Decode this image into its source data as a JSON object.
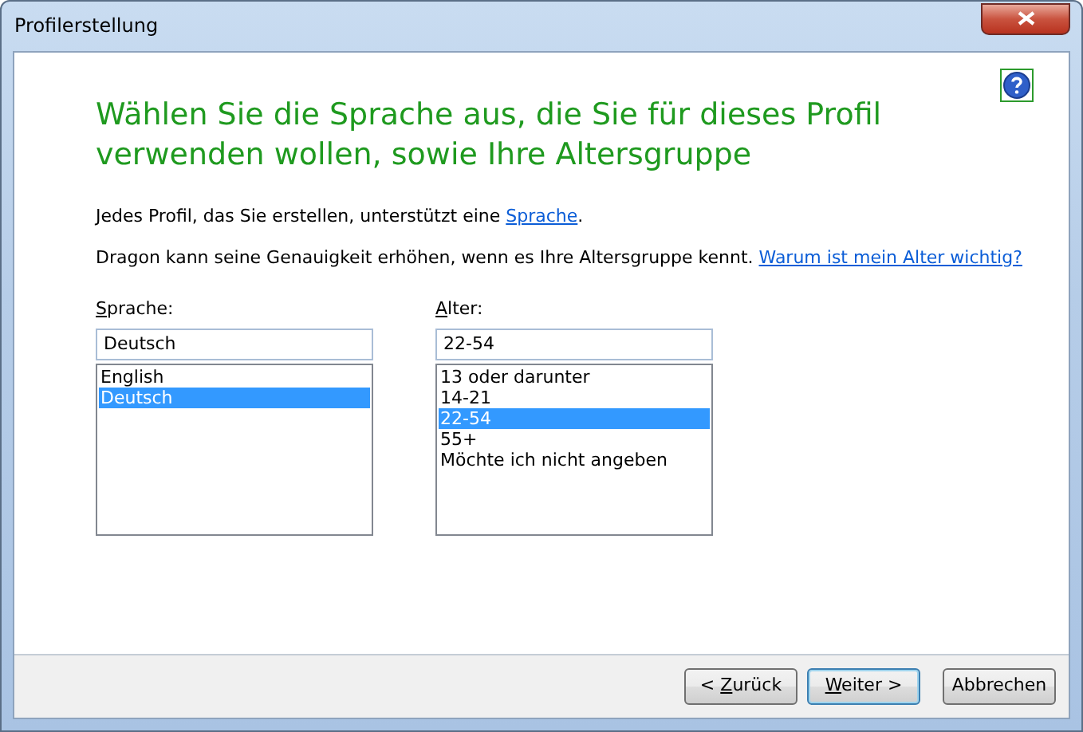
{
  "window": {
    "title": "Profilerstellung"
  },
  "heading": "Wählen Sie die Sprache aus, die Sie für dieses Profil verwenden wollen, sowie Ihre Altersgruppe",
  "info_lines": [
    {
      "text": "Jedes Profil, das Sie erstellen, unterstützt eine ",
      "link": "Sprache",
      "after": "."
    },
    {
      "text": "Dragon kann seine Genauigkeit erhöhen, wenn es Ihre Altersgruppe kennt. ",
      "link": "Warum ist mein Alter wichtig?"
    }
  ],
  "pickers": [
    {
      "label": {
        "key": "S",
        "after": "prache:"
      },
      "value": "Deutsch",
      "items": [
        {
          "text": "English",
          "selected": false
        },
        {
          "text": "Deutsch",
          "selected": true
        }
      ]
    },
    {
      "label": {
        "key": "A",
        "after": "lter:"
      },
      "value": "22-54",
      "items": [
        {
          "text": "13 oder darunter",
          "selected": false
        },
        {
          "text": "14-21",
          "selected": false
        },
        {
          "text": "22-54",
          "selected": true
        },
        {
          "text": "55+",
          "selected": false
        },
        {
          "text": "Möchte ich nicht angeben",
          "selected": false
        }
      ]
    }
  ],
  "buttons": [
    {
      "label": {
        "before": "< ",
        "key": "Z",
        "after": "urück"
      },
      "default": false
    },
    {
      "label": {
        "key": "W",
        "after": "eiter >"
      },
      "default": true
    },
    {
      "label": {
        "key": "Abbrechen"
      },
      "default": false
    }
  ]
}
